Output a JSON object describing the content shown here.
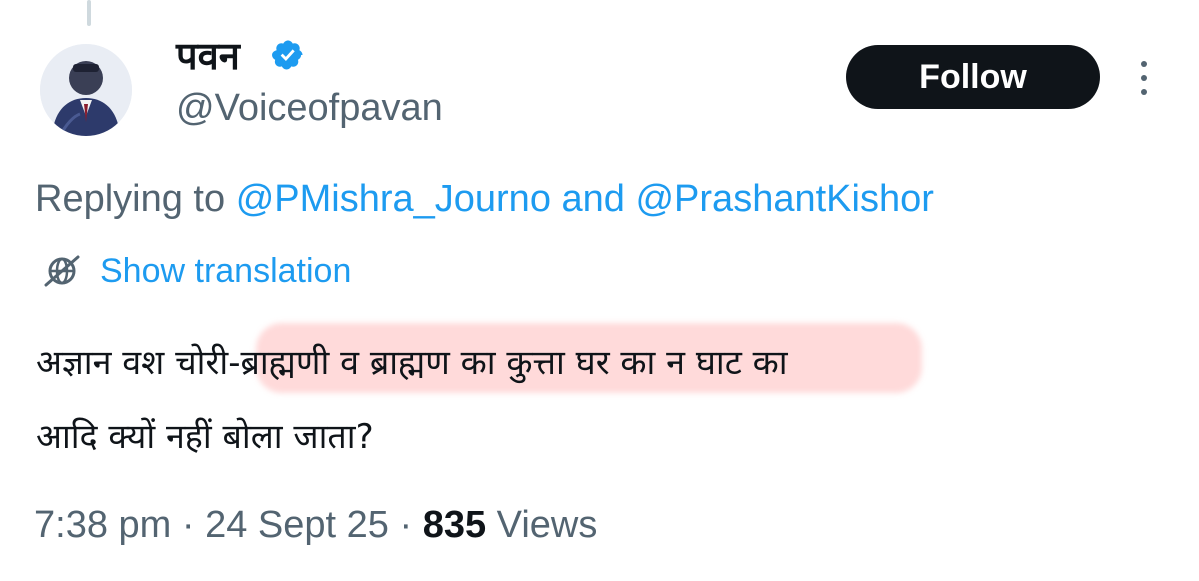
{
  "author": {
    "display_name": "पवन",
    "handle": "@Voiceofpavan",
    "verified": true
  },
  "follow_label": "Follow",
  "reply": {
    "prefix": "Replying to",
    "mention1": "@PMishra_Journo",
    "joiner": "and",
    "mention2": "@PrashantKishor"
  },
  "translation": {
    "label": "Show translation"
  },
  "tweet": {
    "text": "अज्ञान वश  चोरी-ब्राह्मणी व ब्राह्मण का कुत्ता घर का न घाट का\nआदि क्यों नहीं बोला जाता?"
  },
  "meta": {
    "time": "7:38 pm",
    "separator": "·",
    "date": "24 Sept 25",
    "views_count": "835",
    "views_label": "Views"
  },
  "colors": {
    "accent": "#1d9bf0",
    "muted": "#536471",
    "text": "#0f1419",
    "button_bg": "#0f1419",
    "highlight": "#ffd0d0"
  },
  "icons": {
    "verified": "verified-badge-icon",
    "more": "more-vertical-icon",
    "translate": "globe-slash-icon"
  }
}
